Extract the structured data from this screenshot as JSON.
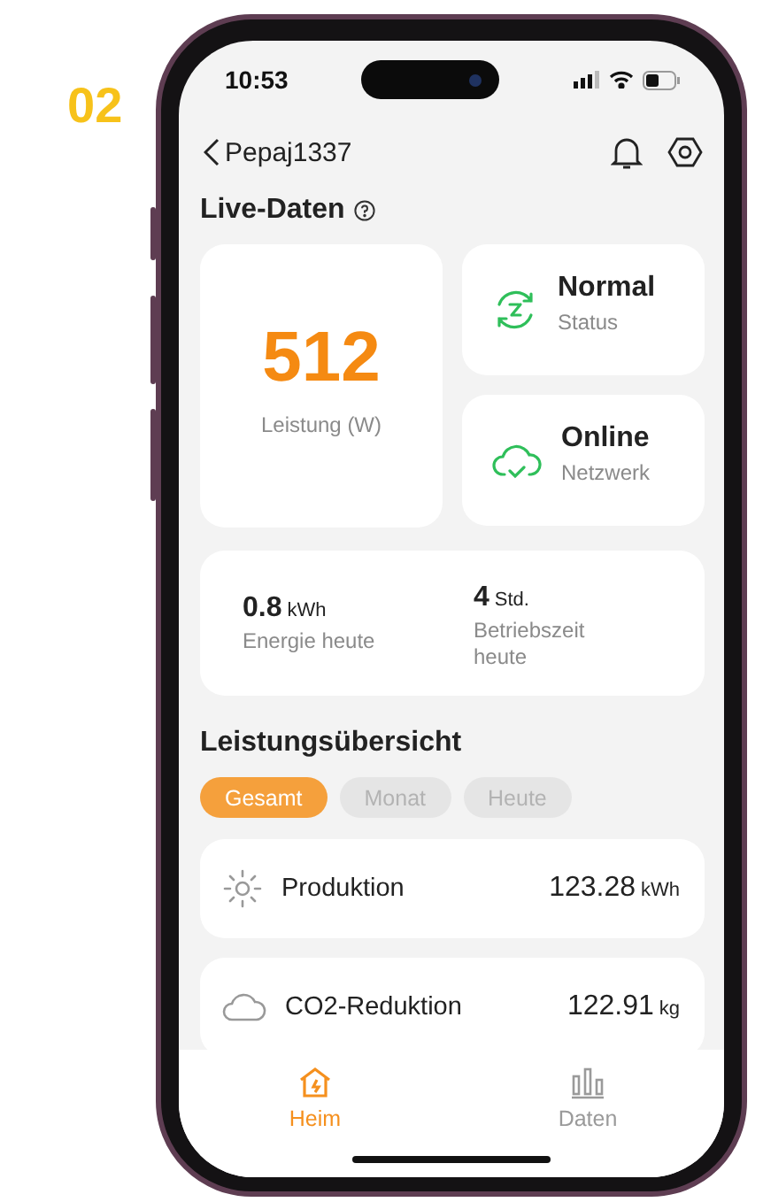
{
  "label": "02",
  "status_bar": {
    "time": "10:53"
  },
  "nav": {
    "title": "Pepaj1337"
  },
  "live": {
    "title": "Live-Daten",
    "power": {
      "value": "512",
      "label": "Leistung (W)"
    },
    "status_cards": [
      {
        "kind": "status",
        "value": "Normal",
        "label": "Status"
      },
      {
        "kind": "network",
        "value": "Online",
        "label": "Netzwerk"
      }
    ],
    "summary": [
      {
        "value": "0.8",
        "unit": "kWh",
        "label": "Energie heute"
      },
      {
        "value": "4",
        "unit": "Std.",
        "label": "Betriebszeit heute"
      }
    ]
  },
  "overview": {
    "title": "Leistungsübersicht",
    "filters": [
      {
        "label": "Gesamt",
        "selected": true
      },
      {
        "label": "Monat",
        "selected": false
      },
      {
        "label": "Heute",
        "selected": false
      }
    ],
    "rows": [
      {
        "kind": "sun",
        "label": "Produktion",
        "value": "123.28",
        "unit": "kWh"
      },
      {
        "kind": "cloud",
        "label": "CO2-Reduktion",
        "value": "122.91",
        "unit": "kg"
      }
    ]
  },
  "tab_bar": [
    {
      "kind": "home",
      "label": "Heim",
      "selected": true
    },
    {
      "kind": "chart",
      "label": "Daten",
      "selected": false
    }
  ]
}
